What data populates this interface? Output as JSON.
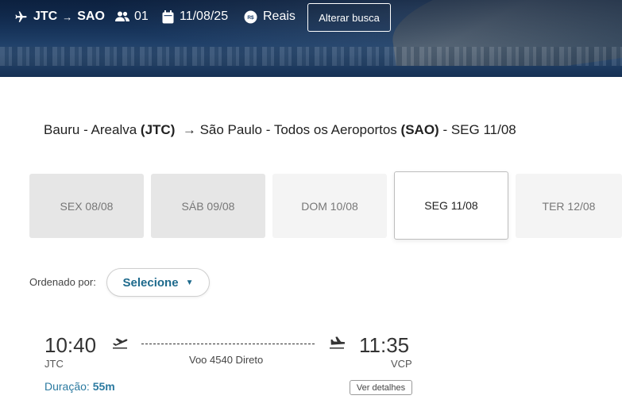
{
  "header": {
    "origin": "JTC",
    "arrow": "→",
    "destination": "SAO",
    "passengers": "01",
    "date": "11/08/25",
    "currency": "Reais",
    "alter_button": "Alterar busca"
  },
  "route": {
    "origin_city": "Bauru - Arealva",
    "origin_code": "(JTC)",
    "arrow": "→",
    "destination_city": "São Paulo - Todos os Aeroportos",
    "destination_code": "(SAO)",
    "date_label": "- SEG 11/08"
  },
  "dates": [
    {
      "label": "SEX 08/08"
    },
    {
      "label": "SÁB 09/08"
    },
    {
      "label": "DOM 10/08"
    },
    {
      "label": "SEG 11/08",
      "selected": true
    },
    {
      "label": "TER 12/08"
    }
  ],
  "sort": {
    "label": "Ordenado por:",
    "value": "Selecione"
  },
  "flight": {
    "depart_time": "10:40",
    "depart_code": "JTC",
    "arrive_time": "11:35",
    "arrive_code": "VCP",
    "info": "Voo 4540 Direto",
    "duration_label": "Duração:",
    "duration_value": "55m",
    "details_button": "Ver detalhes"
  },
  "colors": {
    "accent": "#1e6a8c",
    "duration": "#2b7aa0"
  }
}
